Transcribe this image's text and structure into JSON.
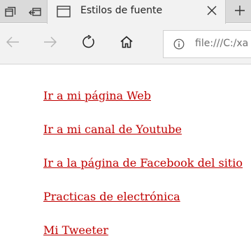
{
  "browser": {
    "tab": {
      "title": "Estilos de fuente"
    },
    "address_bar": {
      "url": "file:///C:/xa"
    },
    "icons": {
      "tab_manager": "tab-manager-icon",
      "set_aside": "set-aside-tabs-icon",
      "page": "page-icon",
      "close": "close-icon",
      "new_tab": "plus-icon",
      "back": "back-arrow-icon",
      "forward": "forward-arrow-icon",
      "refresh": "refresh-icon",
      "home": "home-icon",
      "info": "info-icon"
    }
  },
  "page": {
    "link_color": "#c00000",
    "links": [
      {
        "label": "Ir a mi página Web"
      },
      {
        "label": "Ir a mi canal de Youtube"
      },
      {
        "label": "Ir a la página de Facebook del sitio"
      },
      {
        "label": "Practicas de electrónica"
      },
      {
        "label": "Mi Tweeter"
      }
    ]
  }
}
